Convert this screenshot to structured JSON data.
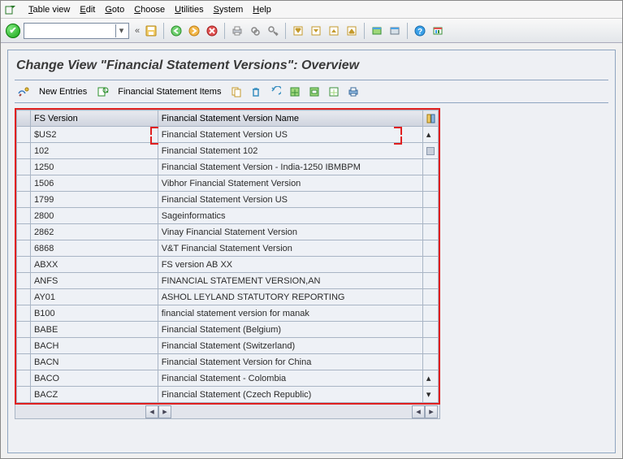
{
  "menu": {
    "items": [
      {
        "u": "T",
        "rest": "able view"
      },
      {
        "u": "E",
        "rest": "dit"
      },
      {
        "u": "G",
        "rest": "oto"
      },
      {
        "u": "C",
        "rest": "hoose"
      },
      {
        "u": "U",
        "rest": "tilities"
      },
      {
        "u": "S",
        "rest": "ystem"
      },
      {
        "u": "H",
        "rest": "elp"
      }
    ]
  },
  "title": "Change View \"Financial Statement Versions\": Overview",
  "subtoolbar": {
    "new_entries": "New Entries",
    "fsi": "Financial Statement Items"
  },
  "columns": {
    "c1": "FS Version",
    "c2": "Financial Statement Version Name"
  },
  "rows": [
    {
      "v": "$US2",
      "n": "Financial Statement Version US"
    },
    {
      "v": "102",
      "n": "Financial Statement 102"
    },
    {
      "v": "1250",
      "n": "Financial Statement Version - India-1250 IBMBPM"
    },
    {
      "v": "1506",
      "n": "Vibhor Financial Statement Version"
    },
    {
      "v": "1799",
      "n": "Financial Statement Version US"
    },
    {
      "v": "2800",
      "n": "Sageinformatics"
    },
    {
      "v": "2862",
      "n": "Vinay Financial Statement Version"
    },
    {
      "v": "6868",
      "n": "V&T Financial Statement Version"
    },
    {
      "v": "ABXX",
      "n": "FS version AB XX"
    },
    {
      "v": "ANFS",
      "n": "FINANCIAL STATEMENT VERSION,AN"
    },
    {
      "v": "AY01",
      "n": "ASHOL LEYLAND STATUTORY REPORTING"
    },
    {
      "v": "B100",
      "n": "financial statement version for manak"
    },
    {
      "v": "BABE",
      "n": "Financial Statement (Belgium)"
    },
    {
      "v": "BACH",
      "n": "Financial Statement (Switzerland)"
    },
    {
      "v": "BACN",
      "n": "Financial Statement Version for China"
    },
    {
      "v": "BACO",
      "n": "Financial Statement - Colombia"
    },
    {
      "v": "BACZ",
      "n": "Financial Statement (Czech Republic)"
    }
  ]
}
